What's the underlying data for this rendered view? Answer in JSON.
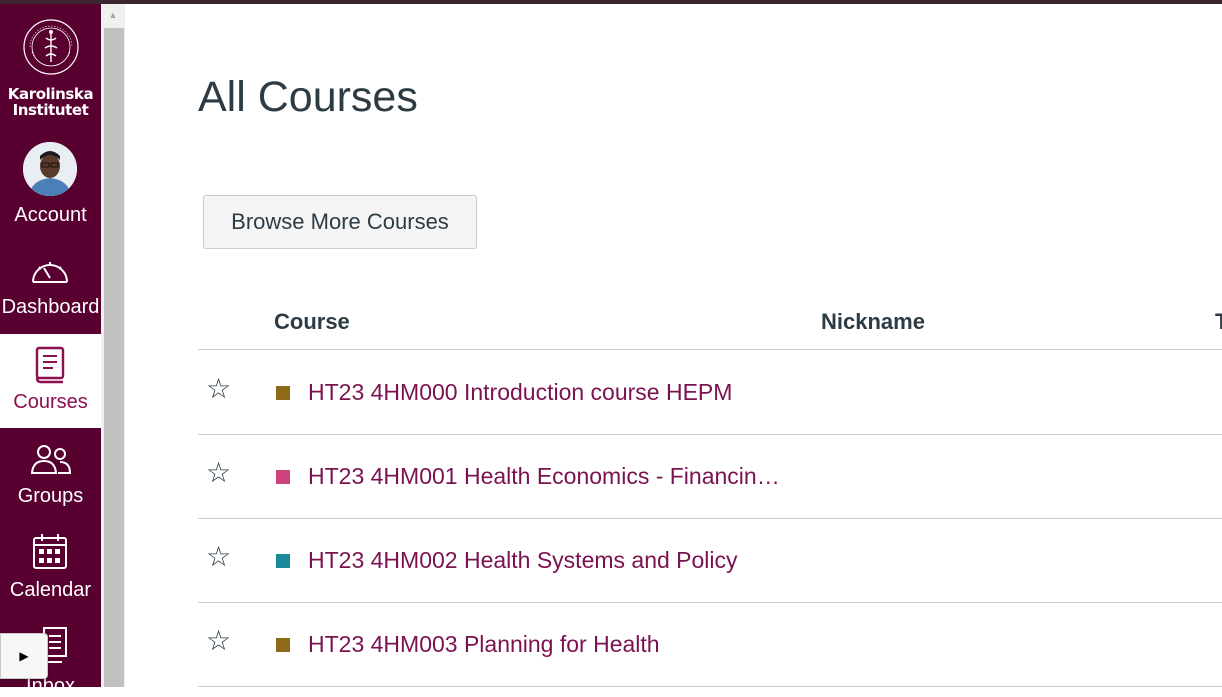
{
  "colors": {
    "nav_background": "#580131",
    "active_nav_text": "#8c0f4f",
    "course_link": "#7b1250",
    "title_text": "#2d3b45"
  },
  "global_nav": {
    "logo_line1": "Karolinska",
    "logo_line2": "Institutet",
    "items": [
      {
        "label": "Account",
        "icon": "avatar"
      },
      {
        "label": "Dashboard",
        "icon": "dashboard-gauge-icon"
      },
      {
        "label": "Courses",
        "icon": "book-icon",
        "active": true
      },
      {
        "label": "Groups",
        "icon": "groups-icon"
      },
      {
        "label": "Calendar",
        "icon": "calendar-icon"
      },
      {
        "label": "Inbox",
        "icon": "inbox-icon"
      }
    ]
  },
  "main": {
    "title": "All Courses",
    "browse_button": "Browse More Courses",
    "table": {
      "headers": {
        "course": "Course",
        "nickname": "Nickname",
        "term": "T"
      },
      "rows": [
        {
          "name": "HT23 4HM000 Introduction course HEPM",
          "color": "#8c6a18",
          "starred": false
        },
        {
          "name": "HT23 4HM001 Health Economics - Financin…",
          "color": "#d0427c",
          "starred": false
        },
        {
          "name": "HT23 4HM002 Health Systems and Policy",
          "color": "#1a8a9a",
          "starred": false
        },
        {
          "name": "HT23 4HM003 Planning for Health",
          "color": "#8c6a18",
          "starred": false
        }
      ]
    }
  }
}
